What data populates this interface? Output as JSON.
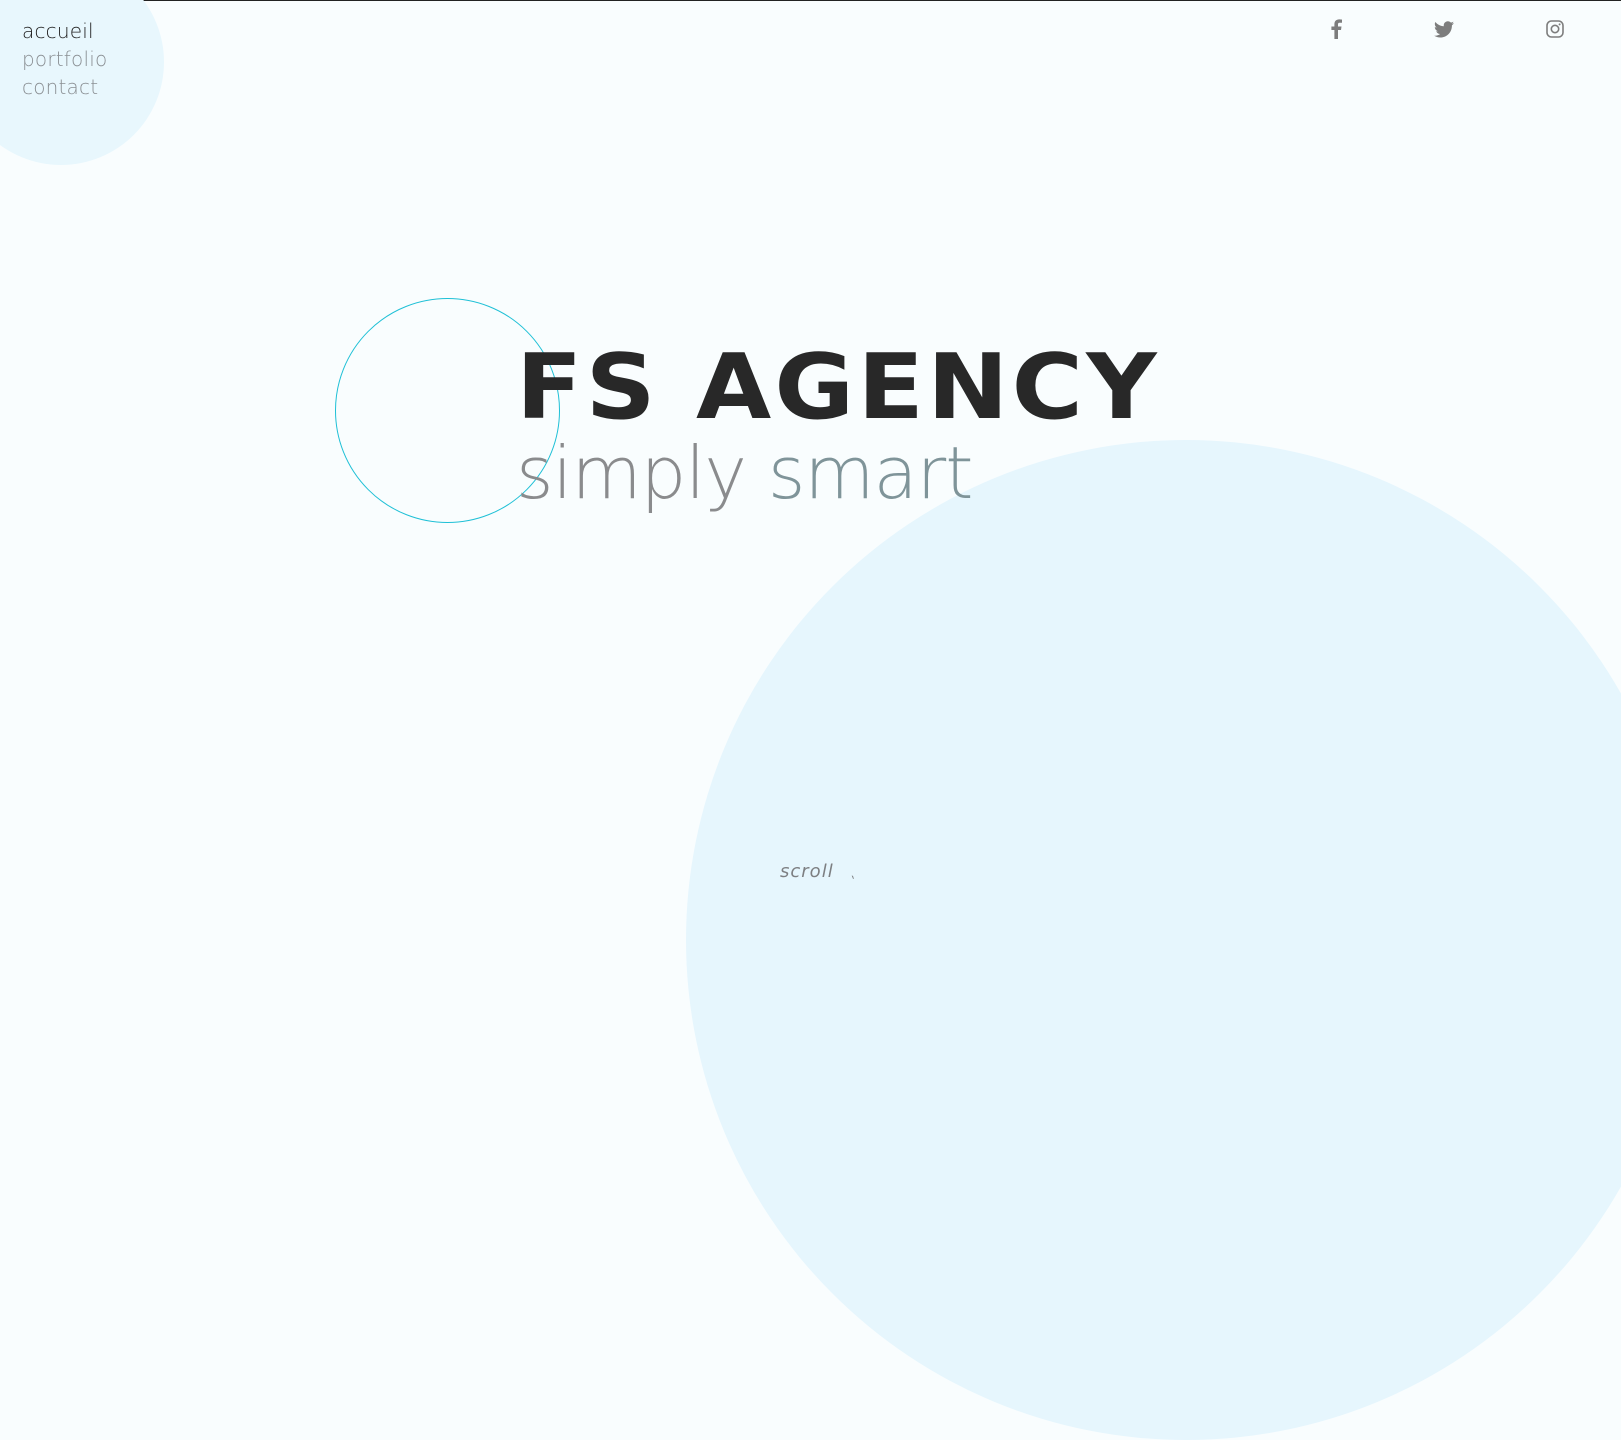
{
  "nav": {
    "items": [
      {
        "label": "accueil",
        "active": true
      },
      {
        "label": "portfolio",
        "active": false
      },
      {
        "label": "contact",
        "active": false
      }
    ]
  },
  "social": {
    "icons": [
      "facebook-icon",
      "twitter-icon",
      "instagram-icon"
    ]
  },
  "hero": {
    "title": "FS AGENCY",
    "subtitle_word1": "simply",
    "subtitle_word2": "smart"
  },
  "scroll": {
    "label": "scroll",
    "arrow": "ˎ"
  },
  "colors": {
    "background": "#f9fdfe",
    "blob": "#e6f6fd",
    "accent_circle": "#1fc0d6",
    "title": "#282828",
    "muted_text": "#8a8f93"
  }
}
